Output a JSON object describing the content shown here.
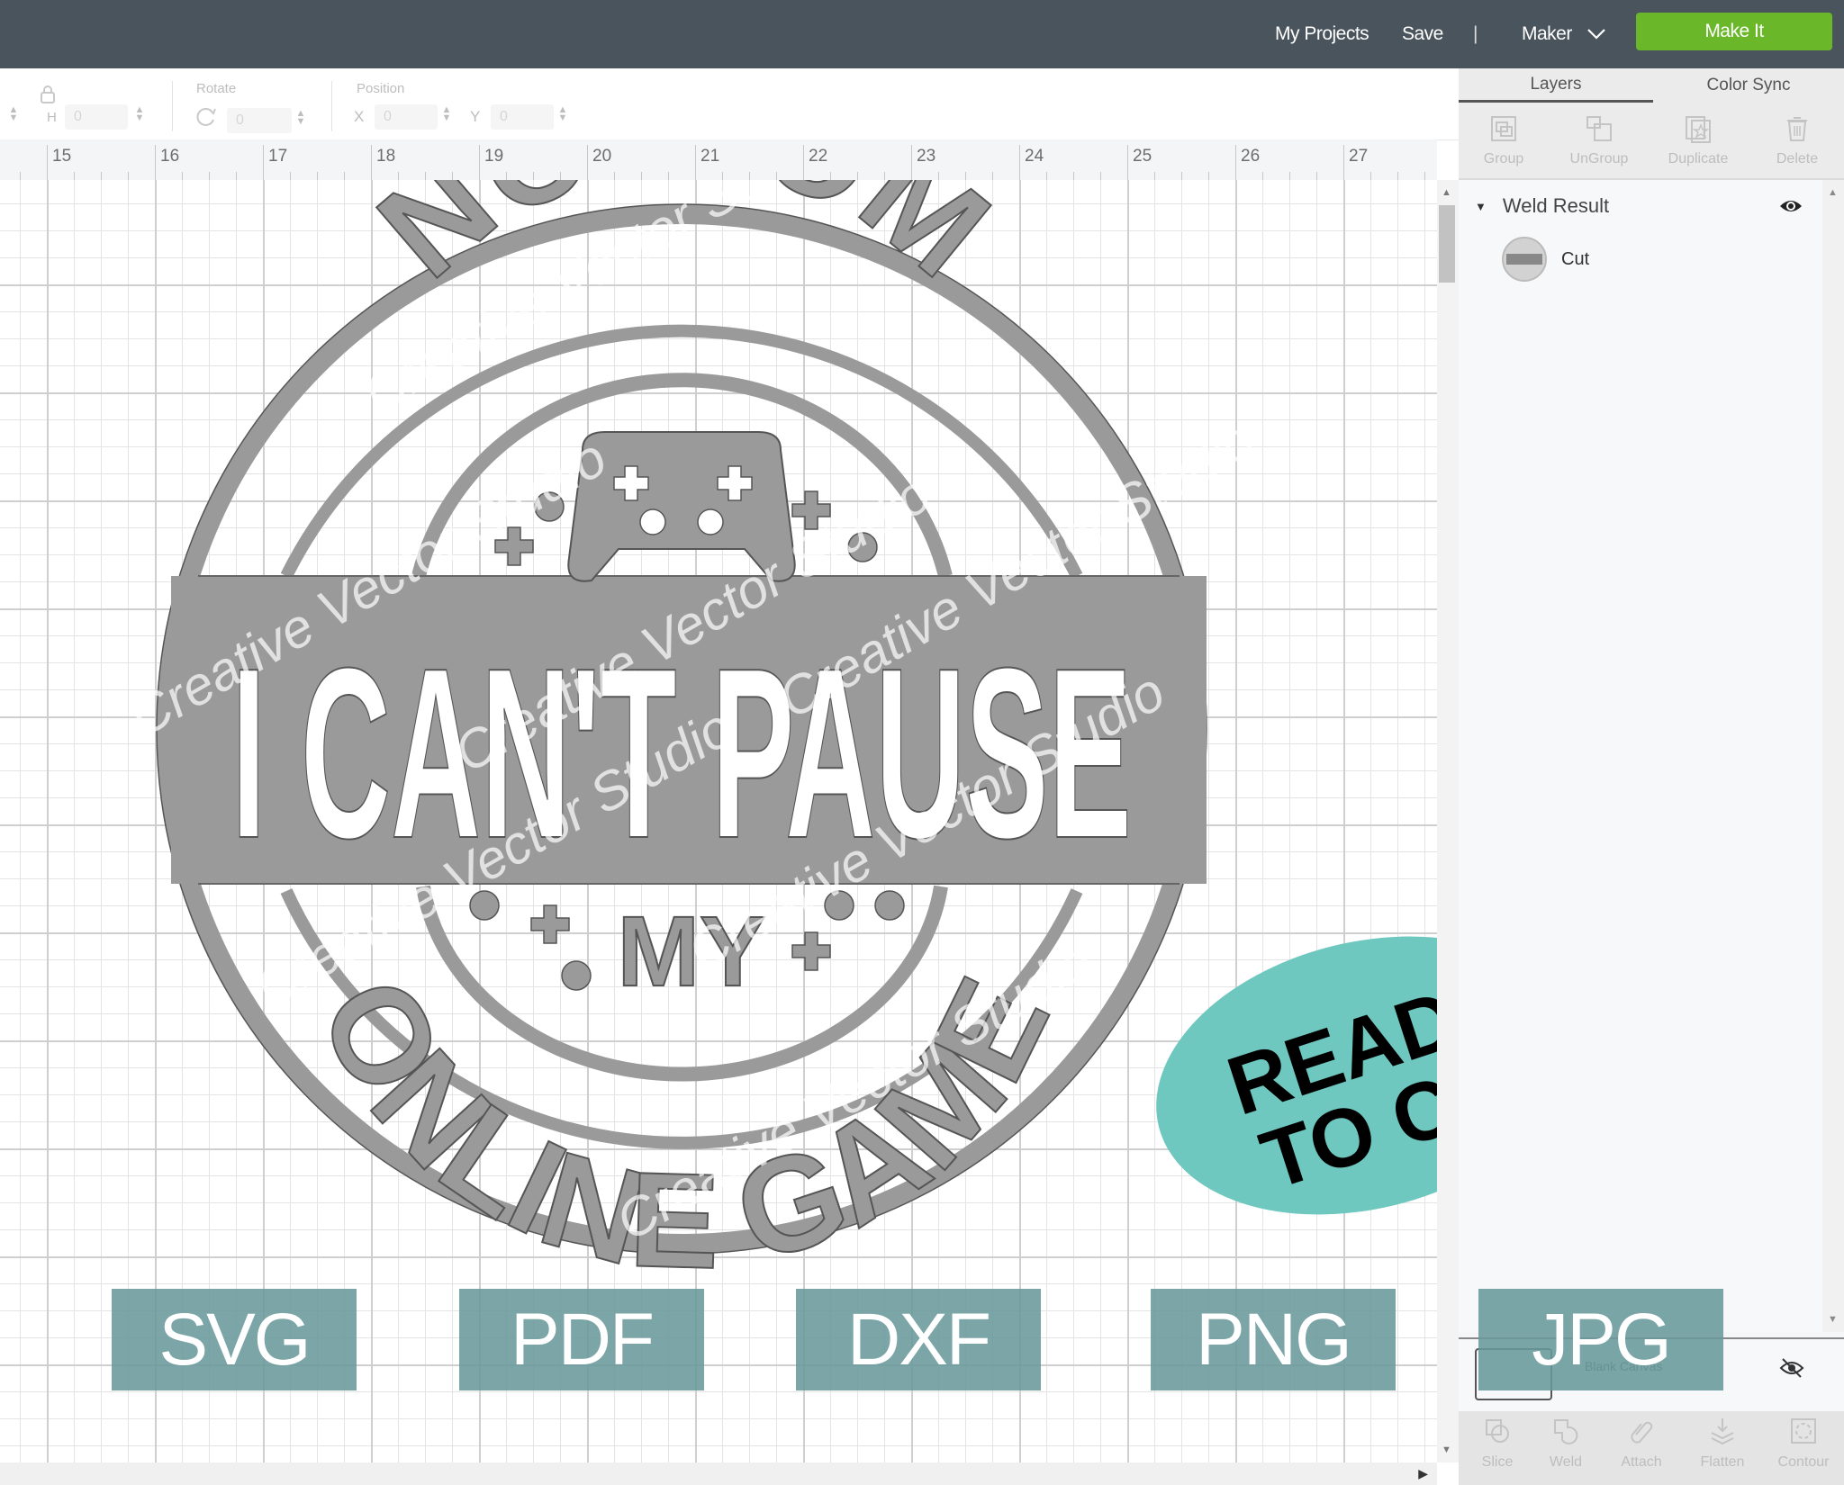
{
  "topbar": {
    "my_projects": "My Projects",
    "save": "Save",
    "separator": "|",
    "machine": "Maker",
    "make_it": "Make It",
    "background_color": "#4a545d",
    "make_it_color": "#6ab82a"
  },
  "toolbar": {
    "size_h_label": "H",
    "size_h_value": "0",
    "rotate_label": "Rotate",
    "rotate_value": "0",
    "position_label": "Position",
    "x_label": "X",
    "x_value": "0",
    "y_label": "Y",
    "y_value": "0"
  },
  "ruler": {
    "ticks": [
      "15",
      "16",
      "17",
      "18",
      "19",
      "20",
      "21",
      "22",
      "23",
      "24",
      "25",
      "26",
      "27"
    ]
  },
  "canvas": {
    "design": {
      "top_text": "NO MOM",
      "main_text": "I CAN'T PAUSE",
      "middle_text": "MY",
      "bottom_text": "ONLINE GAME",
      "fill_color": "#9a9a9a"
    },
    "watermark": "Creative Vector Studio",
    "badge": {
      "line1": "READY",
      "line2": "TO CUT",
      "color": "#6fc8bf"
    },
    "formats": [
      "SVG",
      "PDF",
      "DXF",
      "PNG",
      "JPG"
    ],
    "format_color": "#69989b"
  },
  "panel": {
    "tabs": [
      {
        "label": "Layers",
        "active": true
      },
      {
        "label": "Color Sync",
        "active": false
      }
    ],
    "tools": [
      {
        "label": "Group",
        "icon": "group-icon"
      },
      {
        "label": "UnGroup",
        "icon": "ungroup-icon"
      },
      {
        "label": "Duplicate",
        "icon": "duplicate-icon"
      },
      {
        "label": "Delete",
        "icon": "delete-icon"
      }
    ],
    "layer_group": "Weld Result",
    "layer_item": "Cut",
    "blank_canvas": "Blank Canvas",
    "bottom_tools": [
      {
        "label": "Slice",
        "icon": "slice-icon"
      },
      {
        "label": "Weld",
        "icon": "weld-icon"
      },
      {
        "label": "Attach",
        "icon": "attach-icon"
      },
      {
        "label": "Flatten",
        "icon": "flatten-icon"
      },
      {
        "label": "Contour",
        "icon": "contour-icon"
      }
    ]
  }
}
